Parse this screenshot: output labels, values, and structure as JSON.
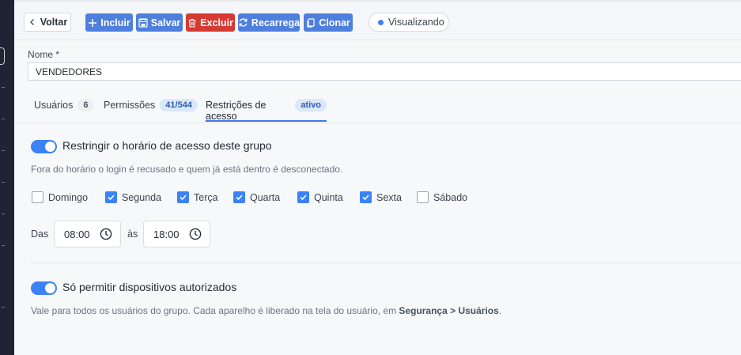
{
  "toolbar": {
    "back_label": "Voltar",
    "include_label": "Incluir",
    "save_label": "Salvar",
    "delete_label": "Excluir",
    "reload_label": "Recarrega",
    "clone_label": "Clonar",
    "status_label": "Visualizando"
  },
  "form": {
    "name_label": "Nome *",
    "name_value": "VENDEDORES"
  },
  "tabs": [
    {
      "label": "Usuários",
      "badge": "6"
    },
    {
      "label": "Permissões",
      "badge": "41/544"
    },
    {
      "label": "Restrições de acesso",
      "badge": "ativo",
      "active": true
    }
  ],
  "schedule": {
    "toggle_label": "Restringir o horário de acesso deste grupo",
    "toggle_on": true,
    "help": "Fora do horário o login é recusado e quem já está dentro é desconectado.",
    "days": [
      {
        "label": "Domingo",
        "checked": false
      },
      {
        "label": "Segunda",
        "checked": true
      },
      {
        "label": "Terça",
        "checked": true
      },
      {
        "label": "Quarta",
        "checked": true
      },
      {
        "label": "Quinta",
        "checked": true
      },
      {
        "label": "Sexta",
        "checked": true
      },
      {
        "label": "Sábado",
        "checked": false
      }
    ],
    "from_label": "Das",
    "from_time": "08:00",
    "to_label": "às",
    "to_time": "18:00"
  },
  "devices": {
    "toggle_label": "Só permitir dispositivos autorizados",
    "toggle_on": true,
    "help_prefix": "Vale para todos os usuários do grupo. Cada aparelho é liberado na tela do usuário, em ",
    "help_path": "Segurança > Usuários",
    "help_suffix": "."
  },
  "colors": {
    "accent": "#3b82f6",
    "primary_button": "#4f7fdc",
    "danger_button": "#d63a33",
    "sidebar": "#1e2433"
  }
}
